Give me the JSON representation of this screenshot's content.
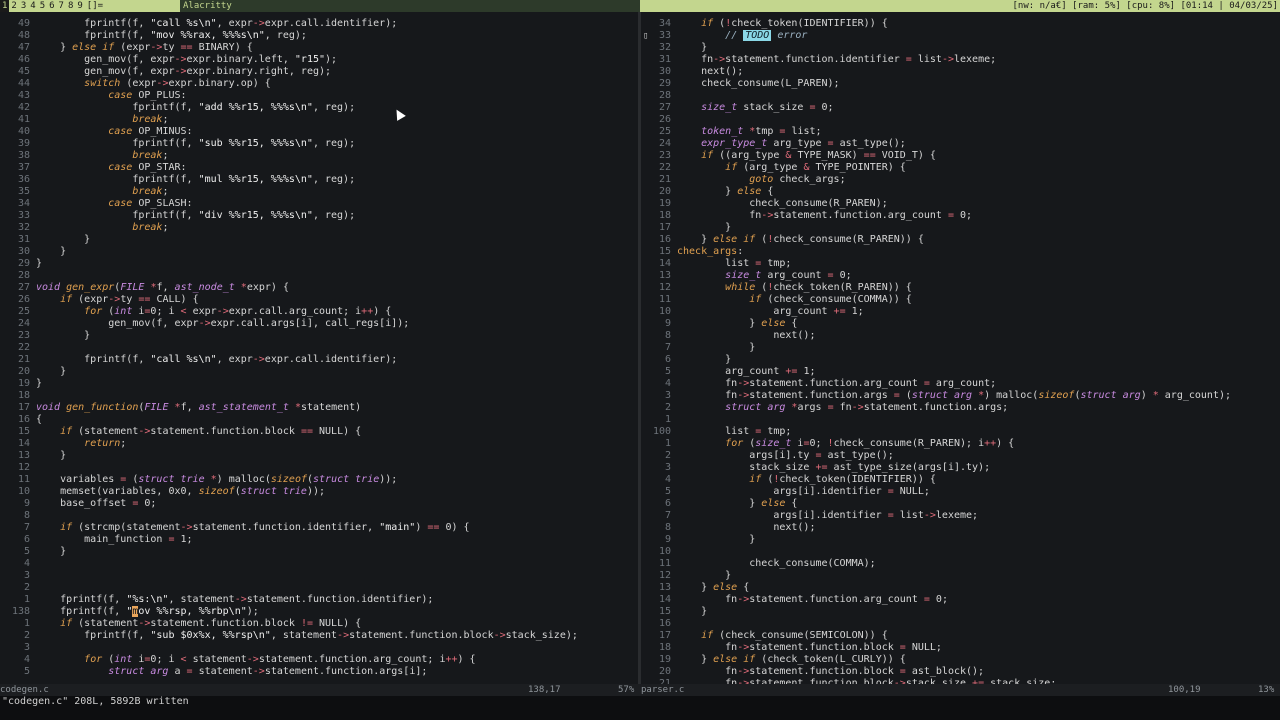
{
  "topbar": {
    "workspaces": [
      "1",
      "2",
      "3",
      "4",
      "5",
      "6",
      "7",
      "8",
      "9",
      "[]="
    ],
    "window_title": "Alacritty",
    "status": "[nw: n/a€] [ram: 5%] [cpu: 8%] [01:14 | 04/03/25]"
  },
  "left_pane": {
    "lines": [
      {
        "n": "49",
        "html": "        fprintf(f, <span class=\"str\">\"call %s\\n\"</span>, expr<span class=\"op\">-></span>expr.call.identifier);"
      },
      {
        "n": "48",
        "html": "        fprintf(f, <span class=\"str\">\"mov %%rax, %%%s\\n\"</span>, reg);"
      },
      {
        "n": "47",
        "html": "    } <span class=\"kw\">else if</span> (expr<span class=\"op\">-></span>ty <span class=\"op\">==</span> BINARY) {"
      },
      {
        "n": "46",
        "html": "        gen_mov(f, expr<span class=\"op\">-></span>expr.binary.left, <span class=\"str\">\"r15\"</span>);"
      },
      {
        "n": "45",
        "html": "        gen_mov(f, expr<span class=\"op\">-></span>expr.binary.right, reg);"
      },
      {
        "n": "44",
        "html": "        <span class=\"kw\">switch</span> (expr<span class=\"op\">-></span>expr.binary.op) {"
      },
      {
        "n": "43",
        "html": "            <span class=\"kw\">case</span> OP_PLUS:"
      },
      {
        "n": "42",
        "html": "                fprintf(f, <span class=\"str\">\"add %%r15, %%%s\\n\"</span>, reg);"
      },
      {
        "n": "41",
        "html": "                <span class=\"kw\">break</span>;"
      },
      {
        "n": "40",
        "html": "            <span class=\"kw\">case</span> OP_MINUS:"
      },
      {
        "n": "39",
        "html": "                fprintf(f, <span class=\"str\">\"sub %%r15, %%%s\\n\"</span>, reg);"
      },
      {
        "n": "38",
        "html": "                <span class=\"kw\">break</span>;"
      },
      {
        "n": "37",
        "html": "            <span class=\"kw\">case</span> OP_STAR:"
      },
      {
        "n": "36",
        "html": "                fprintf(f, <span class=\"str\">\"mul %%r15, %%%s\\n\"</span>, reg);"
      },
      {
        "n": "35",
        "html": "                <span class=\"kw\">break</span>;"
      },
      {
        "n": "34",
        "html": "            <span class=\"kw\">case</span> OP_SLASH:"
      },
      {
        "n": "33",
        "html": "                fprintf(f, <span class=\"str\">\"div %%r15, %%%s\\n\"</span>, reg);"
      },
      {
        "n": "32",
        "html": "                <span class=\"kw\">break</span>;"
      },
      {
        "n": "31",
        "html": "        }"
      },
      {
        "n": "30",
        "html": "    }"
      },
      {
        "n": "29",
        "html": "}"
      },
      {
        "n": "28",
        "html": ""
      },
      {
        "n": "27",
        "html": "<span class=\"ty\">void</span> <span class=\"kw\">gen_expr</span>(<span class=\"ty\">FILE</span> <span class=\"op\">*</span>f, <span class=\"ty\">ast_node_t</span> <span class=\"op\">*</span>expr) {"
      },
      {
        "n": "26",
        "html": "    <span class=\"kw\">if</span> (expr<span class=\"op\">-></span>ty <span class=\"op\">==</span> CALL) {"
      },
      {
        "n": "25",
        "html": "        <span class=\"kw\">for</span> (<span class=\"ty\">int</span> i<span class=\"op\">=</span>0; i <span class=\"op\">&lt;</span> expr<span class=\"op\">-></span>expr.call.arg_count; i<span class=\"op\">++</span>) {"
      },
      {
        "n": "24",
        "html": "            gen_mov(f, expr<span class=\"op\">-></span>expr.call.args[i], call_regs[i]);"
      },
      {
        "n": "23",
        "html": "        }"
      },
      {
        "n": "22",
        "html": ""
      },
      {
        "n": "21",
        "html": "        fprintf(f, <span class=\"str\">\"call %s\\n\"</span>, expr<span class=\"op\">-></span>expr.call.identifier);"
      },
      {
        "n": "20",
        "html": "    }"
      },
      {
        "n": "19",
        "html": "}"
      },
      {
        "n": "18",
        "html": ""
      },
      {
        "n": "17",
        "html": "<span class=\"ty\">void</span> <span class=\"kw\">gen_function</span>(<span class=\"ty\">FILE</span> <span class=\"op\">*</span>f, <span class=\"ty\">ast_statement_t</span> <span class=\"op\">*</span>statement)"
      },
      {
        "n": "16",
        "html": "{"
      },
      {
        "n": "15",
        "html": "    <span class=\"kw\">if</span> (statement<span class=\"op\">-></span>statement.function.block <span class=\"op\">==</span> NULL) {"
      },
      {
        "n": "14",
        "html": "        <span class=\"kw\">return</span>;"
      },
      {
        "n": "13",
        "html": "    }"
      },
      {
        "n": "12",
        "html": ""
      },
      {
        "n": "11",
        "html": "    variables <span class=\"op\">=</span> (<span class=\"ty\">struct trie</span> <span class=\"op\">*</span>) malloc(<span class=\"kw\">sizeof</span>(<span class=\"ty\">struct trie</span>));"
      },
      {
        "n": "10",
        "html": "    memset(variables, 0x0, <span class=\"kw\">sizeof</span>(<span class=\"ty\">struct trie</span>));"
      },
      {
        "n": "9",
        "html": "    base_offset <span class=\"op\">=</span> 0;"
      },
      {
        "n": "8",
        "html": ""
      },
      {
        "n": "7",
        "html": "    <span class=\"kw\">if</span> (strcmp(statement<span class=\"op\">-></span>statement.function.identifier, <span class=\"str\">\"main\"</span>) <span class=\"op\">==</span> 0) {"
      },
      {
        "n": "6",
        "html": "        main_function <span class=\"op\">=</span> 1;"
      },
      {
        "n": "5",
        "html": "    }"
      },
      {
        "n": "4",
        "html": ""
      },
      {
        "n": "3",
        "html": ""
      },
      {
        "n": "2",
        "html": ""
      },
      {
        "n": "1",
        "html": "    fprintf(f, <span class=\"str\">\"%s:\\n\"</span>, statement<span class=\"op\">-></span>statement.function.identifier);"
      },
      {
        "n": "138",
        "html": "    fprintf(f, <span class=\"str\">\"<span class=\"cursor\">m</span>ov %%rsp, %%rbp\\n\"</span>);"
      },
      {
        "n": "1",
        "html": "    <span class=\"kw\">if</span> (statement<span class=\"op\">-></span>statement.function.block <span class=\"op\">!=</span> NULL) {"
      },
      {
        "n": "2",
        "html": "        fprintf(f, <span class=\"str\">\"sub $0x%x, %%rsp\\n\"</span>, statement<span class=\"op\">-></span>statement.function.block<span class=\"op\">-></span>stack_size);"
      },
      {
        "n": "3",
        "html": ""
      },
      {
        "n": "4",
        "html": "        <span class=\"kw\">for</span> (<span class=\"ty\">int</span> i<span class=\"op\">=</span>0; i <span class=\"op\">&lt;</span> statement<span class=\"op\">-></span>statement.function.arg_count; i<span class=\"op\">++</span>) {"
      },
      {
        "n": "5",
        "html": "            <span class=\"ty\">struct arg</span> a <span class=\"op\">=</span> statement<span class=\"op\">-></span>statement.function.args[i];"
      }
    ]
  },
  "right_pane": {
    "lines": [
      {
        "n": "34",
        "html": "    <span class=\"kw\">if</span> (<span class=\"op\">!</span>check_token(IDENTIFIER)) {"
      },
      {
        "n": "33",
        "html": "        <span class=\"cmt\">// </span><span class=\"todo\">TODO</span><span class=\"cmt\"> error</span>",
        "mark": "▯"
      },
      {
        "n": "32",
        "html": "    }"
      },
      {
        "n": "31",
        "html": "    fn<span class=\"op\">-></span>statement.function.identifier <span class=\"op\">=</span> list<span class=\"op\">-></span>lexeme;"
      },
      {
        "n": "30",
        "html": "    next();"
      },
      {
        "n": "29",
        "html": "    check_consume(L_PAREN);"
      },
      {
        "n": "28",
        "html": ""
      },
      {
        "n": "27",
        "html": "    <span class=\"ty\">size_t</span> stack_size <span class=\"op\">=</span> 0;"
      },
      {
        "n": "26",
        "html": ""
      },
      {
        "n": "25",
        "html": "    <span class=\"ty\">token_t</span> <span class=\"op\">*</span>tmp <span class=\"op\">=</span> list;"
      },
      {
        "n": "24",
        "html": "    <span class=\"ty\">expr_type_t</span> arg_type <span class=\"op\">=</span> ast_type();"
      },
      {
        "n": "23",
        "html": "    <span class=\"kw\">if</span> ((arg_type <span class=\"op\">&amp;</span> TYPE_MASK) <span class=\"op\">==</span> VOID_T) {"
      },
      {
        "n": "22",
        "html": "        <span class=\"kw\">if</span> (arg_type <span class=\"op\">&amp;</span> TYPE_POINTER) {"
      },
      {
        "n": "21",
        "html": "            <span class=\"kw\">goto</span> check_args;"
      },
      {
        "n": "20",
        "html": "        } <span class=\"kw\">else</span> {"
      },
      {
        "n": "19",
        "html": "            check_consume(R_PAREN);"
      },
      {
        "n": "18",
        "html": "            fn<span class=\"op\">-></span>statement.function.arg_count <span class=\"op\">=</span> 0;"
      },
      {
        "n": "17",
        "html": "        }"
      },
      {
        "n": "16",
        "html": "    } <span class=\"kw\">else if</span> (<span class=\"op\">!</span>check_consume(R_PAREN)) {"
      },
      {
        "n": "15",
        "html": "<span class=\"lab\">check_args</span>:"
      },
      {
        "n": "14",
        "html": "        list <span class=\"op\">=</span> tmp;"
      },
      {
        "n": "13",
        "html": "        <span class=\"ty\">size_t</span> arg_count <span class=\"op\">=</span> 0;"
      },
      {
        "n": "12",
        "html": "        <span class=\"kw\">while</span> (<span class=\"op\">!</span>check_token(R_PAREN)) {"
      },
      {
        "n": "11",
        "html": "            <span class=\"kw\">if</span> (check_consume(COMMA)) {"
      },
      {
        "n": "10",
        "html": "                arg_count <span class=\"op\">+=</span> 1;"
      },
      {
        "n": "9",
        "html": "            } <span class=\"kw\">else</span> {"
      },
      {
        "n": "8",
        "html": "                next();"
      },
      {
        "n": "7",
        "html": "            }"
      },
      {
        "n": "6",
        "html": "        }"
      },
      {
        "n": "5",
        "html": "        arg_count <span class=\"op\">+=</span> 1;"
      },
      {
        "n": "4",
        "html": "        fn<span class=\"op\">-></span>statement.function.arg_count <span class=\"op\">=</span> arg_count;"
      },
      {
        "n": "3",
        "html": "        fn<span class=\"op\">-></span>statement.function.args <span class=\"op\">=</span> (<span class=\"ty\">struct arg</span> <span class=\"op\">*</span>) malloc(<span class=\"kw\">sizeof</span>(<span class=\"ty\">struct arg</span>) <span class=\"op\">*</span> arg_count);"
      },
      {
        "n": "2",
        "html": "        <span class=\"ty\">struct arg</span> <span class=\"op\">*</span>args <span class=\"op\">=</span> fn<span class=\"op\">-></span>statement.function.args;"
      },
      {
        "n": "1",
        "html": ""
      },
      {
        "n": "100",
        "html": "        list <span class=\"op\">=</span> tmp;"
      },
      {
        "n": "1",
        "html": "        <span class=\"kw\">for</span> (<span class=\"ty\">size_t</span> i<span class=\"op\">=</span>0; <span class=\"op\">!</span>check_consume(R_PAREN); i<span class=\"op\">++</span>) {"
      },
      {
        "n": "2",
        "html": "            args[i].ty <span class=\"op\">=</span> ast_type();"
      },
      {
        "n": "3",
        "html": "            stack_size <span class=\"op\">+=</span> ast_type_size(args[i].ty);"
      },
      {
        "n": "4",
        "html": "            <span class=\"kw\">if</span> (<span class=\"op\">!</span>check_token(IDENTIFIER)) {"
      },
      {
        "n": "5",
        "html": "                args[i].identifier <span class=\"op\">=</span> NULL;"
      },
      {
        "n": "6",
        "html": "            } <span class=\"kw\">else</span> {"
      },
      {
        "n": "7",
        "html": "                args[i].identifier <span class=\"op\">=</span> list<span class=\"op\">-></span>lexeme;"
      },
      {
        "n": "8",
        "html": "                next();"
      },
      {
        "n": "9",
        "html": "            }"
      },
      {
        "n": "10",
        "html": ""
      },
      {
        "n": "11",
        "html": "            check_consume(COMMA);"
      },
      {
        "n": "12",
        "html": "        }"
      },
      {
        "n": "13",
        "html": "    } <span class=\"kw\">else</span> {"
      },
      {
        "n": "14",
        "html": "        fn<span class=\"op\">-></span>statement.function.arg_count <span class=\"op\">=</span> 0;"
      },
      {
        "n": "15",
        "html": "    }"
      },
      {
        "n": "16",
        "html": ""
      },
      {
        "n": "17",
        "html": "    <span class=\"kw\">if</span> (check_consume(SEMICOLON)) {"
      },
      {
        "n": "18",
        "html": "        fn<span class=\"op\">-></span>statement.function.block <span class=\"op\">=</span> NULL;"
      },
      {
        "n": "19",
        "html": "    } <span class=\"kw\">else if</span> (check_token(L_CURLY)) {"
      },
      {
        "n": "20",
        "html": "        fn<span class=\"op\">-></span>statement.function.block <span class=\"op\">=</span> ast_block();"
      },
      {
        "n": "21",
        "html": "        fn<span class=\"op\">-></span>statement.function.block<span class=\"op\">-></span>stack_size <span class=\"op\">+=</span> stack_size;"
      }
    ]
  },
  "statusline": {
    "left_file": "codegen.c",
    "left_pos": "138,17",
    "left_pct": "57%",
    "right_file": "parser.c",
    "right_pos": "100,19",
    "right_pct": "13%"
  },
  "cmdline": "\"codegen.c\" 208L, 5892B written"
}
